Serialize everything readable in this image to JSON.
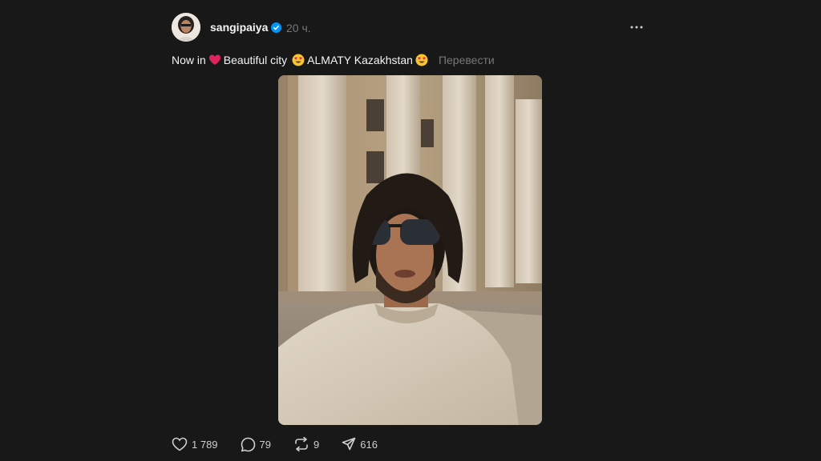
{
  "post": {
    "username": "sangipaiya",
    "verified_icon": "verified-badge-icon",
    "timestamp": "20 ч.",
    "caption": {
      "part1": "Now in",
      "part2": "Beautiful city",
      "part3": "ALMATY Kazakhstan",
      "translate_label": "Перевести",
      "emojis": [
        "red-heart-emoji",
        "heart-eyes-emoji",
        "heart-eyes-emoji"
      ]
    },
    "photo_subject": "selfie-photo",
    "actions": {
      "likes": "1 789",
      "replies": "79",
      "reposts": "9",
      "shares": "616"
    }
  },
  "colors": {
    "background": "#181818",
    "text": "#f3f5f7",
    "muted": "#777777",
    "verified": "#0095f6",
    "heart": "#e0245e"
  }
}
